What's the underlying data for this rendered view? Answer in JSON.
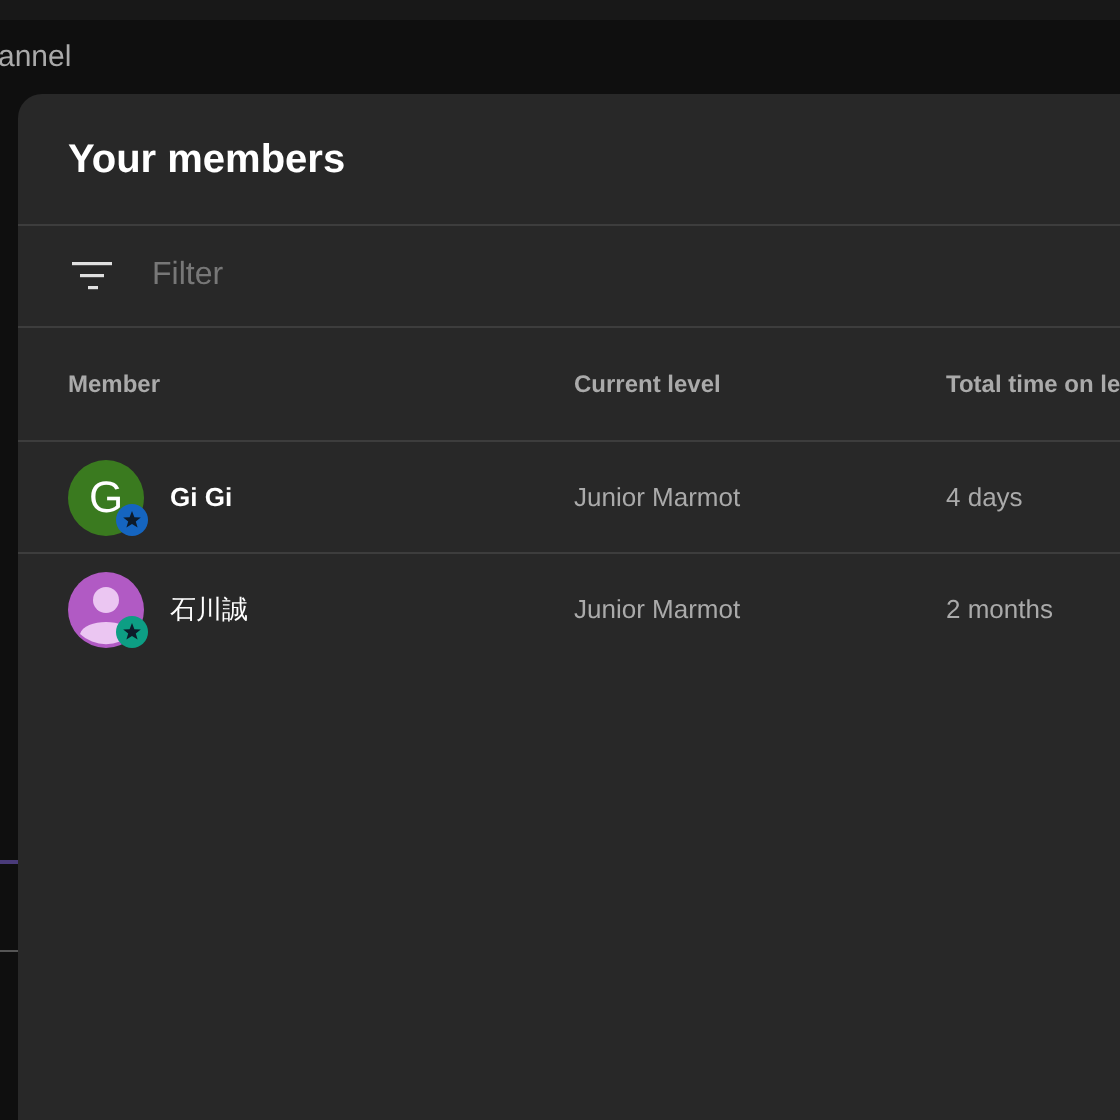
{
  "background": {
    "channel_label": "annel"
  },
  "dialog": {
    "title": "Your members",
    "filter": {
      "placeholder": "Filter"
    },
    "table": {
      "columns": [
        "Member",
        "Current level",
        "Total time on le"
      ],
      "rows": [
        {
          "avatar": {
            "kind": "letter",
            "letter": "G",
            "color": "#3a7a1f"
          },
          "badge": {
            "color": "#1565c0"
          },
          "name": "Gi Gi",
          "level": "Junior Marmot",
          "time": "4 days"
        },
        {
          "avatar": {
            "kind": "silhouette",
            "color": "#b15ac4"
          },
          "badge": {
            "color": "#0d9e84"
          },
          "name": "石川誠",
          "level": "Junior Marmot",
          "time": "2 months"
        }
      ]
    }
  }
}
